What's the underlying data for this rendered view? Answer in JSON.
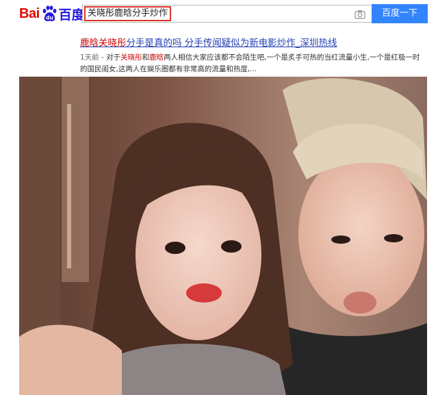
{
  "header": {
    "logo_left": "Bai",
    "logo_right": "百度",
    "logo_colors": {
      "red": "#e10601",
      "blue": "#2319dc"
    },
    "search_query": "关晓彤鹿晗分手炒作",
    "search_button": "百度一下",
    "camera_icon": "camera-icon"
  },
  "result": {
    "title_parts": [
      "鹿晗",
      "关晓彤",
      "分手是真的吗 分手传闻疑似为新电影炒作_深圳热线"
    ],
    "date": "1天前 - ",
    "snippet_parts": [
      "对于",
      "关晓彤",
      "和",
      "鹿晗",
      "两人相信大家应该都不会陌生吧,一个是炙手可热的当红流量小生,一个是红极一时的国民闺女,这两人在娱乐圈都有非常高的流量和热度,..."
    ]
  },
  "colors": {
    "link": "#2440b3",
    "highlight": "#cc0000",
    "button": "#3385ff",
    "query_border": "#d9342b"
  },
  "photo": {
    "description_icon": "photo-image"
  }
}
